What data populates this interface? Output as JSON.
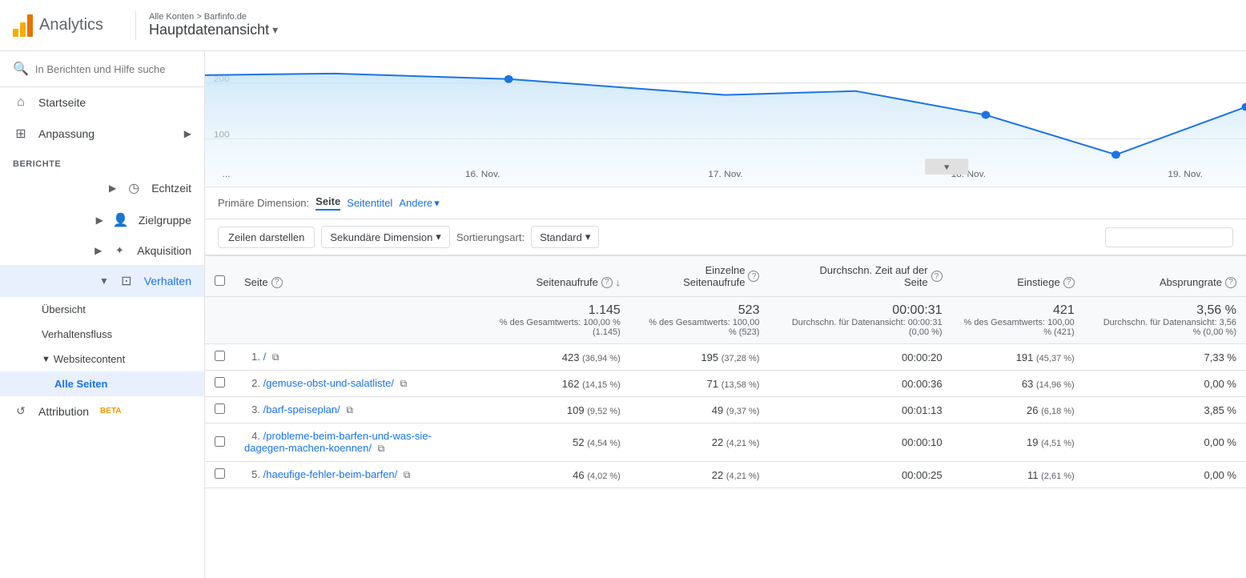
{
  "header": {
    "analytics_label": "Analytics",
    "breadcrumb": "Alle Konten > Barfinfo.de",
    "title": "Hauptdatenansicht",
    "title_arrow": "▾"
  },
  "sidebar": {
    "search_placeholder": "In Berichten und Hilfe suche",
    "items": [
      {
        "id": "startseite",
        "label": "Startseite",
        "icon": "⌂"
      },
      {
        "id": "anpassung",
        "label": "Anpassung",
        "icon": "⊞"
      }
    ],
    "section_berichte": "BERICHTE",
    "sub_items": [
      {
        "id": "echtzeit",
        "label": "Echtzeit",
        "icon": "◷",
        "expandable": true
      },
      {
        "id": "zielgruppe",
        "label": "Zielgruppe",
        "icon": "👤",
        "expandable": true
      },
      {
        "id": "akquisition",
        "label": "Akquisition",
        "icon": "✦",
        "expandable": true
      },
      {
        "id": "verhalten",
        "label": "Verhalten",
        "icon": "⊡",
        "expandable": true,
        "active": true
      }
    ],
    "verhalten_children": [
      {
        "id": "uebersicht",
        "label": "Übersicht"
      },
      {
        "id": "verhaltensfluss",
        "label": "Verhaltensfluss"
      },
      {
        "id": "websitecontent",
        "label": "Websitecontent",
        "expandable": true
      }
    ],
    "websitecontent_children": [
      {
        "id": "alle-seiten",
        "label": "Alle Seiten",
        "active": true
      }
    ],
    "attribution": {
      "label": "Attribution",
      "badge": "BETA"
    }
  },
  "dimension": {
    "label": "Primäre Dimension:",
    "options": [
      {
        "id": "seite",
        "label": "Seite",
        "active": true
      },
      {
        "id": "seitentitel",
        "label": "Seitentitel",
        "active": false
      },
      {
        "id": "andere",
        "label": "Andere",
        "dropdown": true
      }
    ]
  },
  "controls": {
    "rows_label": "Zeilen darstellen",
    "secondary_dim": "Sekundäre Dimension",
    "sort_label": "Sortierungsart:",
    "sort_value": "Standard",
    "search_placeholder": ""
  },
  "table": {
    "columns": [
      {
        "id": "seite",
        "label": "Seite",
        "align": "left",
        "help": true,
        "sort": true
      },
      {
        "id": "seitenaufrufe",
        "label": "Seitenaufrufe",
        "align": "right",
        "help": true,
        "sort": false
      },
      {
        "id": "einzelne",
        "label": "Einzelne Seitenaufrufe",
        "align": "right",
        "help": true
      },
      {
        "id": "durchschn",
        "label": "Durchschn. Zeit auf der Seite",
        "align": "right",
        "help": true
      },
      {
        "id": "einstiege",
        "label": "Einstiege",
        "align": "right",
        "help": true
      },
      {
        "id": "absprungrate",
        "label": "Absprungrate",
        "align": "right",
        "help": true
      }
    ],
    "totals": {
      "seitenaufrufe": "1.145",
      "seitenaufrufe_sub": "% des Gesamtwerts: 100,00 % (1.145)",
      "einzelne": "523",
      "einzelne_sub": "% des Gesamtwerts: 100,00 % (523)",
      "durchschn": "00:00:31",
      "durchschn_sub": "Durchschn. für Datenansicht: 00:00:31 (0,00 %)",
      "einstiege": "421",
      "einstiege_sub": "% des Gesamtwerts: 100,00 % (421)",
      "absprungrate": "3,56 %",
      "absprungrate_sub": "Durchschn. für Datenansicht: 3,56 % (0,00 %)"
    },
    "rows": [
      {
        "num": "1.",
        "page": "/",
        "seitenaufrufe": "423",
        "seitenaufrufe_sub": "(36,94 %)",
        "einzelne": "195",
        "einzelne_sub": "(37,28 %)",
        "durchschn": "00:00:20",
        "einstiege": "191",
        "einstiege_sub": "(45,37 %)",
        "absprungrate": "7,33 %"
      },
      {
        "num": "2.",
        "page": "/gemuse-obst-und-salatliste/",
        "seitenaufrufe": "162",
        "seitenaufrufe_sub": "(14,15 %)",
        "einzelne": "71",
        "einzelne_sub": "(13,58 %)",
        "durchschn": "00:00:36",
        "einstiege": "63",
        "einstiege_sub": "(14,96 %)",
        "absprungrate": "0,00 %"
      },
      {
        "num": "3.",
        "page": "/barf-speiseplan/",
        "seitenaufrufe": "109",
        "seitenaufrufe_sub": "(9,52 %)",
        "einzelne": "49",
        "einzelne_sub": "(9,37 %)",
        "durchschn": "00:01:13",
        "einstiege": "26",
        "einstiege_sub": "(6,18 %)",
        "absprungrate": "3,85 %"
      },
      {
        "num": "4.",
        "page": "/probleme-beim-barfen-und-was-sie-dagegen-machen-koennen/",
        "seitenaufrufe": "52",
        "seitenaufrufe_sub": "(4,54 %)",
        "einzelne": "22",
        "einzelne_sub": "(4,21 %)",
        "durchschn": "00:00:10",
        "einstiege": "19",
        "einstiege_sub": "(4,51 %)",
        "absprungrate": "0,00 %"
      },
      {
        "num": "5.",
        "page": "/haeufige-fehler-beim-barfen/",
        "seitenaufrufe": "46",
        "seitenaufrufe_sub": "(4,02 %)",
        "einzelne": "22",
        "einzelne_sub": "(4,21 %)",
        "durchschn": "00:00:25",
        "einstiege": "11",
        "einstiege_sub": "(2,61 %)",
        "absprungrate": "0,00 %"
      }
    ]
  },
  "chart": {
    "x_labels": [
      "...",
      "16. Nov.",
      "17. Nov.",
      "18. Nov.",
      "19. Nov."
    ],
    "y_labels": [
      "200",
      "100"
    ],
    "accent_color": "#1a73e8",
    "fill_color": "#c5e3f7"
  }
}
